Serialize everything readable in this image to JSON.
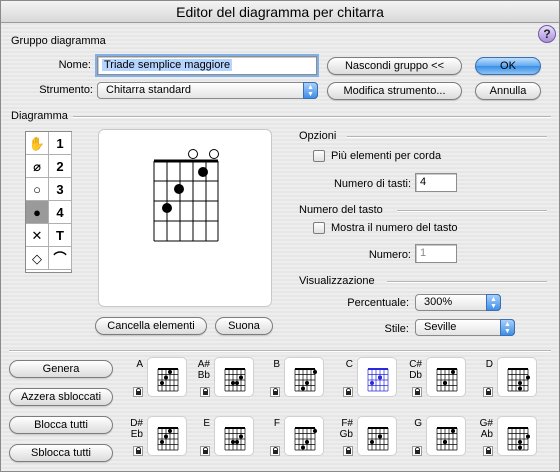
{
  "window": {
    "title": "Editor del diagramma per chitarra"
  },
  "help": {
    "label": "?"
  },
  "gruppo": {
    "section_title": "Gruppo diagramma",
    "nome_label": "Nome:",
    "nome_value": "Triade semplice maggiore",
    "strumento_label": "Strumento:",
    "strumento_value": "Chitarra standard",
    "nascondi_button": "Nascondi gruppo <<",
    "modifica_button": "Modifica strumento...",
    "ok_button": "OK",
    "annulla_button": "Annulla"
  },
  "diagramma": {
    "section_title": "Diagramma",
    "tools": [
      {
        "glyph": "✋",
        "name": "hand-tool"
      },
      {
        "glyph": "1",
        "name": "finger-1-tool"
      },
      {
        "glyph": "⌀",
        "name": "eraser-tool"
      },
      {
        "glyph": "2",
        "name": "finger-2-tool"
      },
      {
        "glyph": "○",
        "name": "open-string-tool"
      },
      {
        "glyph": "3",
        "name": "finger-3-tool"
      },
      {
        "glyph": "●",
        "name": "dot-tool"
      },
      {
        "glyph": "4",
        "name": "finger-4-tool"
      },
      {
        "glyph": "✕",
        "name": "mute-tool"
      },
      {
        "glyph": "T",
        "name": "thumb-tool"
      },
      {
        "glyph": "◇",
        "name": "diamond-tool"
      },
      {
        "glyph": "⌒",
        "name": "barre-tool"
      }
    ],
    "cancella_button": "Cancella elementi",
    "suona_button": "Suona"
  },
  "opzioni": {
    "section_title": "Opzioni",
    "piu_elementi_label": "Più elementi per corda",
    "piu_elementi_checked": false,
    "numero_tasti_label": "Numero di tasti:",
    "numero_tasti_value": "4"
  },
  "numero_tasto": {
    "section_title": "Numero del tasto",
    "mostra_label": "Mostra il numero del tasto",
    "mostra_checked": false,
    "numero_label": "Numero:",
    "numero_value": "1"
  },
  "visualizzazione": {
    "section_title": "Visualizzazione",
    "percentuale_label": "Percentuale:",
    "percentuale_value": "300%",
    "stile_label": "Stile:",
    "stile_value": "Seville"
  },
  "actions": {
    "genera": "Genera",
    "azzera": "Azzera sbloccati",
    "blocca": "Blocca tutti",
    "sblocca": "Sblocca tutti"
  },
  "chords_row1": [
    {
      "name": "A"
    },
    {
      "name": "A#\nBb"
    },
    {
      "name": "B"
    },
    {
      "name": "C",
      "selected": true,
      "accent": "#2a2ad8"
    },
    {
      "name": "C#\nDb"
    },
    {
      "name": "D"
    }
  ],
  "chords_row2": [
    {
      "name": "D#\nEb"
    },
    {
      "name": "E"
    },
    {
      "name": "F"
    },
    {
      "name": "F#\nGb"
    },
    {
      "name": "G"
    },
    {
      "name": "G#\nAb"
    }
  ]
}
